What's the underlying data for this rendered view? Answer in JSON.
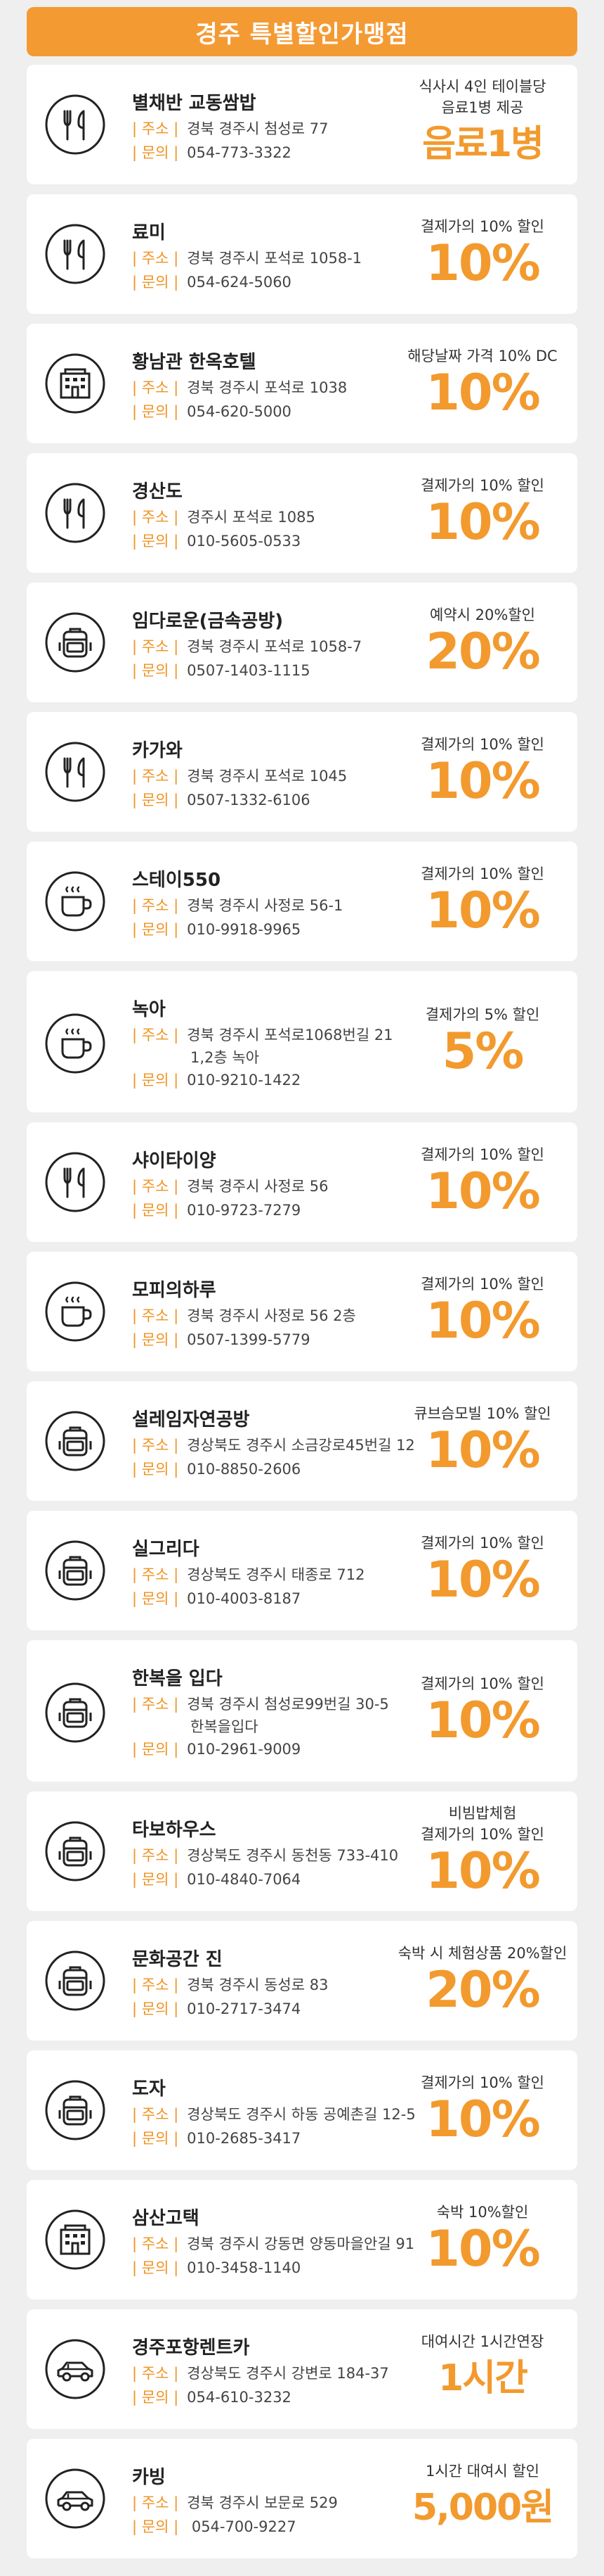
{
  "header": {
    "title": "경주 특별할인가맹점"
  },
  "labels": {
    "address": "| 주소 |",
    "phone": "| 문의 |"
  },
  "colors": {
    "accent": "#f49a33",
    "text": "#222222",
    "card": "#ffffff",
    "background": "#efefef"
  },
  "stores": [
    {
      "icon": "utensils-icon",
      "name": "별채반 교동쌈밥",
      "address": "경북 경주시 첨성로 77",
      "phone": "054-773-3322",
      "benefit_lines": [
        "식사시 4인 테이블당",
        "음료1병 제공"
      ],
      "benefit_big": "음료1병"
    },
    {
      "icon": "utensils-icon",
      "name": "료미",
      "address": "경북 경주시 포석로 1058-1",
      "phone": "054-624-5060",
      "benefit_lines": [
        "결제가의 10% 할인"
      ],
      "benefit_big": "10%"
    },
    {
      "icon": "building-icon",
      "name": "황남관 한옥호텔",
      "address": "경북 경주시 포석로 1038",
      "phone": "054-620-5000",
      "benefit_lines": [
        "해당날짜 가격 10% DC"
      ],
      "benefit_big": "10%"
    },
    {
      "icon": "utensils-icon",
      "name": "경산도",
      "address": "경주시 포석로 1085",
      "phone": "010-5605-0533",
      "benefit_lines": [
        "결제가의 10% 할인"
      ],
      "benefit_big": "10%"
    },
    {
      "icon": "backpack-icon",
      "name": "임다로운(금속공방)",
      "address": "경북 경주시 포석로 1058-7",
      "phone": "0507-1403-1115",
      "benefit_lines": [
        "예약시 20%할인"
      ],
      "benefit_big": "20%"
    },
    {
      "icon": "utensils-icon",
      "name": "카가와",
      "address": "경북 경주시 포석로 1045",
      "phone": "0507-1332-6106",
      "benefit_lines": [
        "결제가의 10% 할인"
      ],
      "benefit_big": "10%"
    },
    {
      "icon": "coffee-icon",
      "name": "스테이550",
      "address": "경북 경주시 사정로 56-1",
      "phone": "010-9918-9965",
      "benefit_lines": [
        "결제가의 10% 할인"
      ],
      "benefit_big": "10%"
    },
    {
      "icon": "coffee-icon",
      "name": "녹아",
      "address": "경북 경주시 포석로1068번길 21",
      "address2": "1,2층 녹아",
      "phone": "010-9210-1422",
      "benefit_lines": [
        "결제가의 5% 할인"
      ],
      "benefit_big": "5%"
    },
    {
      "icon": "utensils-icon",
      "name": "샤이타이양",
      "address": "경북 경주시 사정로 56",
      "phone": "010-9723-7279",
      "benefit_lines": [
        "결제가의 10% 할인"
      ],
      "benefit_big": "10%"
    },
    {
      "icon": "coffee-icon",
      "name": "모피의하루",
      "address": "경북 경주시 사정로 56 2층",
      "phone": "0507-1399-5779",
      "benefit_lines": [
        "결제가의 10% 할인"
      ],
      "benefit_big": "10%"
    },
    {
      "icon": "backpack-icon",
      "name": "설레임자연공방",
      "address": "경상북도 경주시 소금강로45번길 12",
      "phone": "010-8850-2606",
      "benefit_lines": [
        "큐브슴모빌 10% 할인"
      ],
      "benefit_big": "10%"
    },
    {
      "icon": "backpack-icon",
      "name": "실그리다",
      "address": "경상북도 경주시 태종로 712",
      "phone": "010-4003-8187",
      "benefit_lines": [
        "결제가의 10% 할인"
      ],
      "benefit_big": "10%"
    },
    {
      "icon": "backpack-icon",
      "name": "한복을 입다",
      "address": "경북 경주시 첨성로99번길 30-5",
      "address2": "한복을입다",
      "phone": "010-2961-9009",
      "benefit_lines": [
        "결제가의 10% 할인"
      ],
      "benefit_big": "10%"
    },
    {
      "icon": "backpack-icon",
      "name": "타보하우스",
      "address": "경상북도 경주시 동천동 733-410",
      "phone": "010-4840-7064",
      "benefit_lines": [
        "비빔밥체험",
        "결제가의 10% 할인"
      ],
      "benefit_big": "10%"
    },
    {
      "icon": "backpack-icon",
      "name": "문화공간 진",
      "address": "경북 경주시 동성로 83",
      "phone": "010-2717-3474",
      "benefit_lines": [
        "숙박 시 체험상품 20%할인"
      ],
      "benefit_big": "20%"
    },
    {
      "icon": "backpack-icon",
      "name": "도자",
      "address": "경상북도 경주시 하동 공예촌길 12-5",
      "phone": "010-2685-3417",
      "benefit_lines": [
        "결제가의 10% 할인"
      ],
      "benefit_big": "10%"
    },
    {
      "icon": "building-icon",
      "name": "삼산고택",
      "address": "경북 경주시 강동면 양동마을안길 91",
      "phone": "010-3458-1140",
      "benefit_lines": [
        "숙박 10%할인"
      ],
      "benefit_big": "10%"
    },
    {
      "icon": "car-icon",
      "name": "경주포항렌트카",
      "address": "경상북도 경주시 강변로 184-37",
      "phone": "054-610-3232",
      "benefit_lines": [
        "대여시간 1시간연장"
      ],
      "benefit_big": "1시간"
    },
    {
      "icon": "car-icon",
      "name": "카빙",
      "address": "경북 경주시 보문로 529",
      "phone": " 054-700-9227",
      "benefit_lines": [
        "1시간 대여시 할인"
      ],
      "benefit_big": "5,000원"
    }
  ]
}
